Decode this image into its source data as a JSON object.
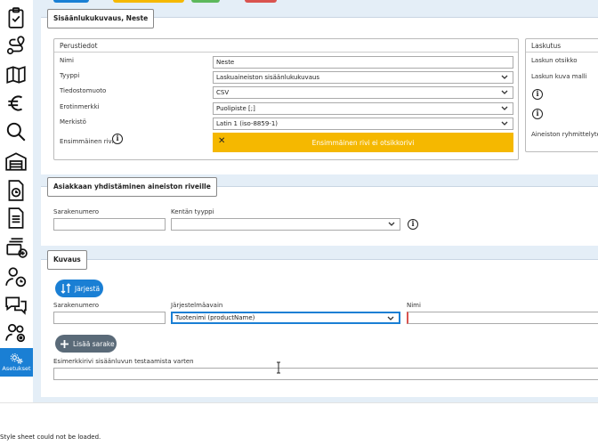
{
  "sidebar": {
    "active_label": "Asetukset"
  },
  "header": {
    "title": "Sisäänlukukuvaus, Neste"
  },
  "perustiedot": {
    "legend": "Perustiedot",
    "nimi_label": "Nimi",
    "nimi_value": "Neste",
    "tyyppi_label": "Tyyppi",
    "tyyppi_value": "Laskuaineiston sisäänlukukuvaus",
    "tiedostomuoto_label": "Tiedostomuoto",
    "tiedostomuoto_value": "CSV",
    "erotinmerkki_label": "Erotinmerkki",
    "erotinmerkki_value": "Puolipiste [;]",
    "merkisto_label": "Merkistö",
    "merkisto_value": "Latin 1 (iso-8859-1)",
    "ensimmainen_label": "Ensimmäinen rivi",
    "ensimmainen_warning": "Ensimmäinen rivi ei otsikkorivi"
  },
  "laskutus": {
    "legend": "Laskutus",
    "otsikko_label": "Laskun otsikko",
    "kuvamalli_label": "Laskun kuva malli",
    "ryhmittely_label": "Aineiston ryhmittelytek"
  },
  "asiakas": {
    "title": "Asiakkaan yhdistäminen aineiston riveille",
    "sarakenumero_label": "Sarakenumero",
    "kentan_tyyppi_label": "Kentän tyyppi"
  },
  "kuvaus": {
    "title": "Kuvaus",
    "sort_button": "Järjestä",
    "sarakenumero_label": "Sarakenumero",
    "jarjestelma_label": "Järjestelmäavain",
    "jarjestelma_value": "Tuotenimi (productName)",
    "nimi_label": "Nimi",
    "add_column_button": "Lisää sarake",
    "example_label": "Esimerkkirivi sisäänluvun testaamista varten"
  },
  "footer_text": "Style sheet could not be loaded."
}
